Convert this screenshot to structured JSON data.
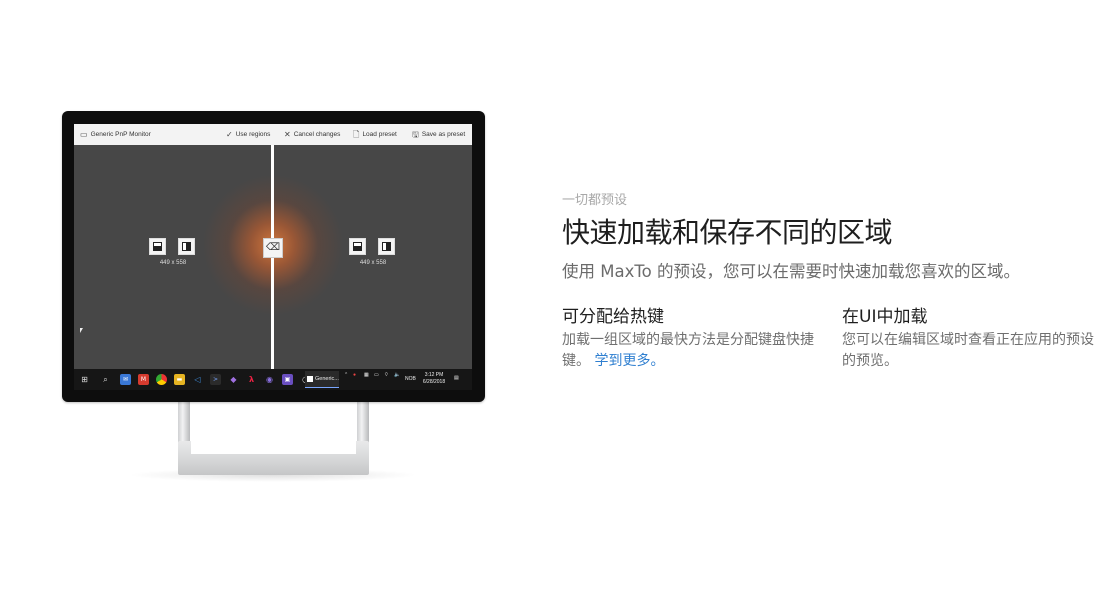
{
  "device": {
    "toolbar": {
      "monitor_name": "Generic PnP Monitor",
      "use_regions": "Use regions",
      "cancel_changes": "Cancel changes",
      "load_preset": "Load preset",
      "save_as_preset": "Save as preset"
    },
    "regions": [
      {
        "size_label": "449 x 558"
      },
      {
        "size_label": "449 x 558"
      }
    ],
    "taskbar": {
      "active_app": "Generic...",
      "language": "NOB",
      "time": "3:12 PM",
      "date": "6/28/2018"
    }
  },
  "content": {
    "eyebrow": "一切都预设",
    "title": "快速加载和保存不同的区域",
    "subtitle": "使用 MaxTo 的预设，您可以在需要时快速加载您喜欢的区域。",
    "features": [
      {
        "title": "可分配给热键",
        "body": "加载一组区域的最快方法是分配键盘快捷键。",
        "link": "学到更多。"
      },
      {
        "title": "在UI中加载",
        "body": "您可以在编辑区域时查看正在应用的预设的预览。"
      }
    ]
  }
}
